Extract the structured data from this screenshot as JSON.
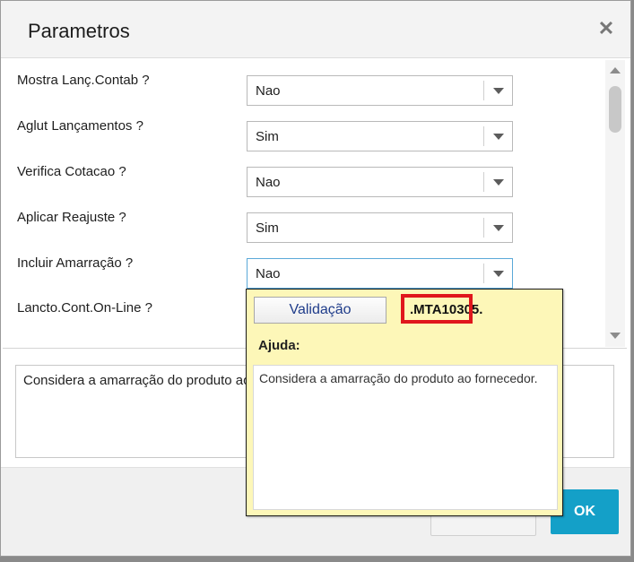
{
  "dialog": {
    "title": "Parametros",
    "close_icon": "close-icon"
  },
  "params": [
    {
      "label": "Mostra Lanç.Contab ?",
      "value": "Nao"
    },
    {
      "label": "Aglut Lançamentos ?",
      "value": "Sim"
    },
    {
      "label": "Verifica Cotacao ?",
      "value": "Nao"
    },
    {
      "label": "Aplicar Reajuste ?",
      "value": "Sim"
    },
    {
      "label": "Incluir Amarração ?",
      "value": "Nao"
    },
    {
      "label": "Lancto.Cont.On-Line ?",
      "value": ""
    }
  ],
  "description": "Considera a amarração do produto ao fornecedor.",
  "help_popup": {
    "validation_button": "Validação",
    "function_name": ".MTA10305.",
    "help_title": "Ajuda:",
    "help_text": "Considera a amarração do produto ao fornecedor."
  },
  "footer": {
    "ok_label": "OK",
    "cancel_label": ""
  },
  "colors": {
    "ok_button": "#14a0c8",
    "help_background": "#fdf7b8",
    "highlight": "#e0161c",
    "focus_border": "#5aa9d8"
  }
}
